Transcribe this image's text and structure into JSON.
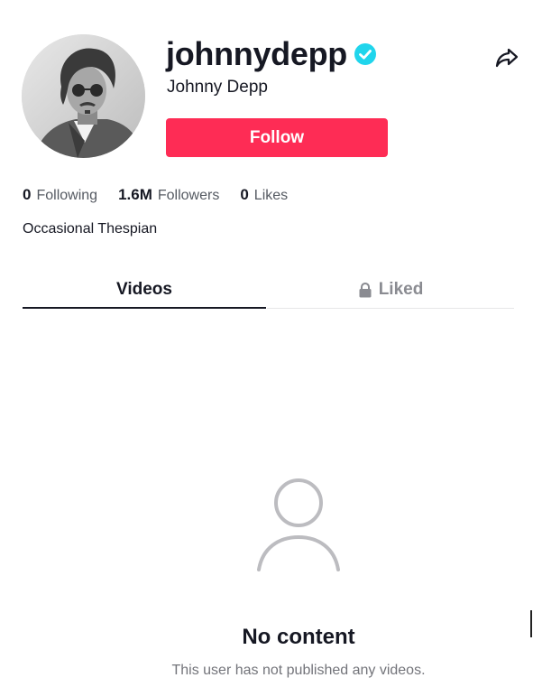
{
  "profile": {
    "username": "johnnydepp",
    "display_name": "Johnny Depp",
    "verified": true,
    "verified_color": "#20d5ec",
    "bio": "Occasional Thespian"
  },
  "actions": {
    "follow_label": "Follow",
    "follow_color": "#fe2c55"
  },
  "stats": [
    {
      "value": "0",
      "label": "Following"
    },
    {
      "value": "1.6M",
      "label": "Followers"
    },
    {
      "value": "0",
      "label": "Likes"
    }
  ],
  "tabs": [
    {
      "label": "Videos",
      "active": true
    },
    {
      "label": "Liked",
      "active": false,
      "icon": "lock-icon"
    }
  ],
  "empty_state": {
    "icon": "user-icon",
    "title": "No content",
    "subtitle": "This user has not published any videos."
  }
}
